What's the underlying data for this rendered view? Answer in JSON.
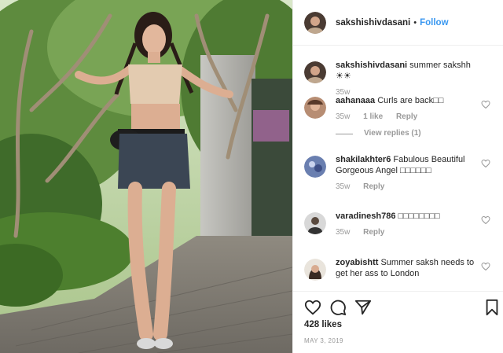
{
  "post": {
    "username": "sakshishivdasani",
    "follow_label": "Follow",
    "separator": "•",
    "likes": "428 likes",
    "date": "MAY 3, 2019"
  },
  "comments": [
    {
      "user": "sakshishivdasani",
      "text": "summer sakshh☀☀",
      "time": "35w",
      "likes": "",
      "reply": "",
      "view_replies": ""
    },
    {
      "user": "aahanaaa",
      "text": "Curls are back□□",
      "time": "35w",
      "likes": "1 like",
      "reply": "Reply",
      "view_replies": "View replies (1)"
    },
    {
      "user": "shakilakhter6",
      "text": "Fabulous Beautiful Gorgeous Angel □□□□□□",
      "time": "35w",
      "likes": "",
      "reply": "Reply",
      "view_replies": ""
    },
    {
      "user": "varadinesh786",
      "text": "□□□□□□□□",
      "time": "35w",
      "likes": "",
      "reply": "Reply",
      "view_replies": ""
    },
    {
      "user": "zoyabishtt",
      "text": "Summer saksh needs to get her ass to London",
      "time": "",
      "likes": "",
      "reply": "",
      "view_replies": ""
    }
  ],
  "icons": {
    "like": "heart-icon",
    "comment": "comment-icon",
    "share": "share-icon",
    "save": "bookmark-icon"
  },
  "colors": {
    "accent": "#3897f0",
    "muted": "#999999",
    "text": "#262626"
  }
}
